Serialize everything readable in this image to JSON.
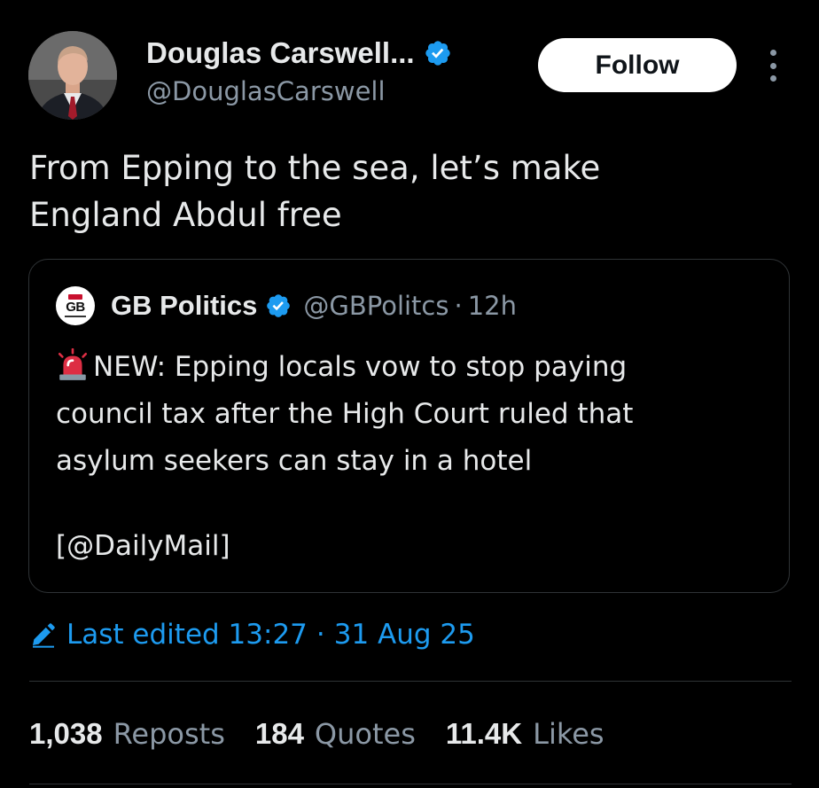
{
  "author": {
    "name": "Douglas Carswell...",
    "handle": "@DouglasCarswell",
    "verified": true,
    "avatar_icon": "person-in-suit-avatar"
  },
  "follow_button": {
    "label": "Follow"
  },
  "more_icon": "vertical-ellipsis-icon",
  "post": {
    "text_line1": "From Epping to the sea, let’s make",
    "text_line2": "England Abdul free"
  },
  "quoted_post": {
    "logo_text": "GB",
    "name": "GB Politics",
    "verified": true,
    "handle": "@GBPolitcs",
    "separator": "·",
    "time": "12h",
    "emoji_icon": "rotating-light-siren-icon",
    "body_line1": "NEW: Epping locals vow to stop paying",
    "body_line2": "council tax after the High Court ruled that",
    "body_line3": "asylum seekers can stay in a hotel",
    "source": "[@DailyMail]"
  },
  "edited": {
    "icon": "pencil-edit-icon",
    "label": "Last edited 13:27",
    "separator": "·",
    "date": "31 Aug 25"
  },
  "stats": [
    {
      "count": "1,038",
      "label": "Reposts"
    },
    {
      "count": "184",
      "label": "Quotes"
    },
    {
      "count": "11.4K",
      "label": "Likes"
    }
  ],
  "colors": {
    "background": "#000000",
    "text_primary": "#e7e9ea",
    "text_secondary": "#8b98a5",
    "accent_blue": "#1d9bf0",
    "border": "#2f3336",
    "follow_bg": "#ffffff"
  }
}
